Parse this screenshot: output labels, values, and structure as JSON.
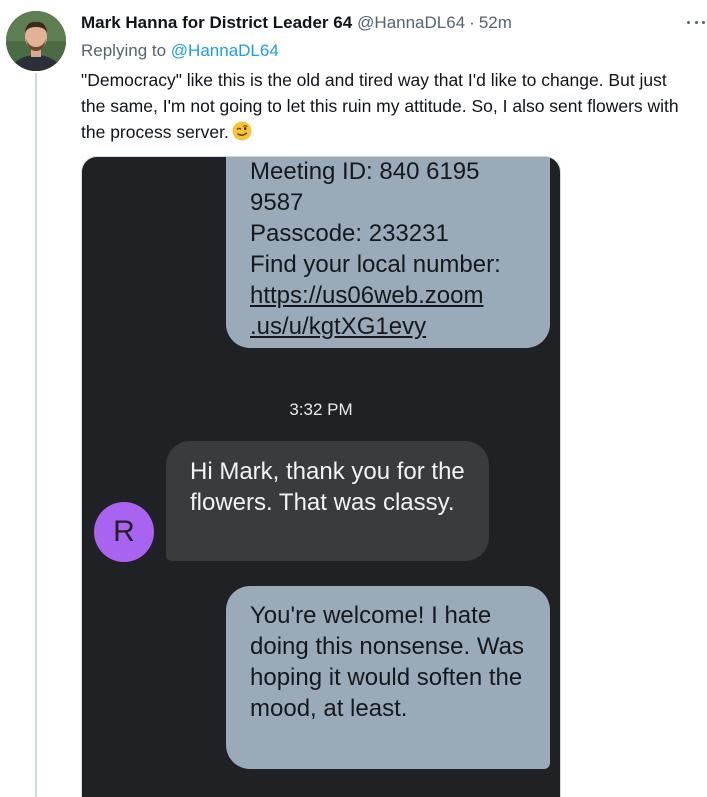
{
  "tweet": {
    "author_name": "Mark Hanna for District Leader 64",
    "handle": "@HannaDL64",
    "separator": "·",
    "time": "52m",
    "reply_prefix": "Replying to",
    "reply_handle": "@HannaDL64",
    "text": "\"Democracy\" like this is the old and tired way that I'd like to change. But just the same, I'm not going to let this ruin my attitude. So, I also sent flowers with the process server.",
    "emoji": "winking-face"
  },
  "screenshot": {
    "message_1": {
      "lines": [
        "Meeting ID: 840 6195",
        "9587",
        "Passcode: 233231",
        "Find your local number:"
      ],
      "link_lines": [
        "https://us06web.zoom",
        ".us/u/kgtXG1evy"
      ]
    },
    "timestamp": "3:32 PM",
    "contact_initial": "R",
    "message_2": "Hi Mark, thank you for the flowers. That was classy.",
    "message_3": "You're welcome! I hate doing this nonsense. Was hoping it would soften the mood, at least."
  },
  "colors": {
    "link": "#1d9bf0",
    "secondary_text": "#536471",
    "chat_background": "#1f2124",
    "outgoing_bubble": "#9aaab9",
    "incoming_bubble": "#3a3b3e",
    "contact_avatar": "#a864f0"
  }
}
